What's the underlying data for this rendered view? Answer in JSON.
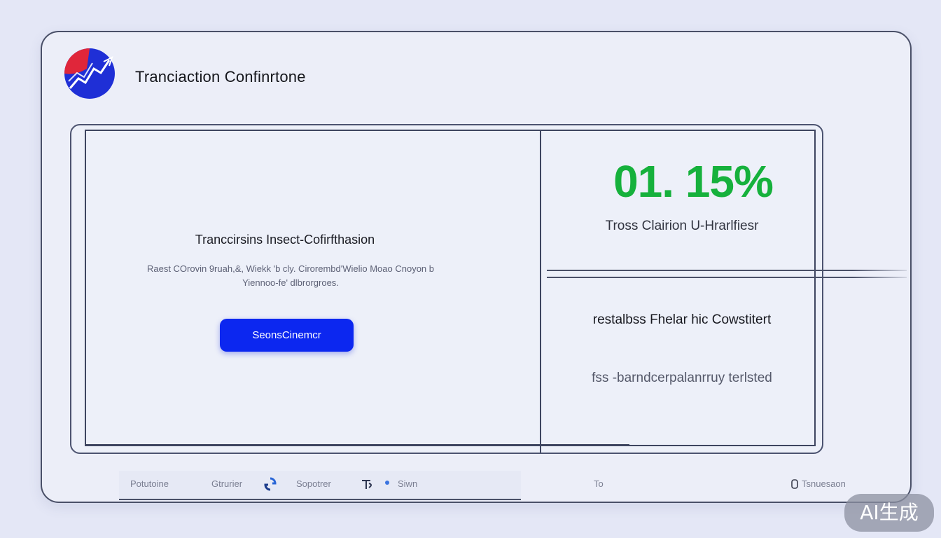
{
  "app": {
    "title": "Tranciaction Confinrtone"
  },
  "main": {
    "heading": "Tranccirsins Insect-Cofirfthasion",
    "description": "Raest COrovin 9ruah,&, Wiekk 'b cly. Cirorembd'Wielio Moao Cnoyon b Yiennoo-fe' dlbrorgroes.",
    "confirm_button": "SeonsCinemcr"
  },
  "summary": {
    "percent": "01. 15%",
    "percent_label": "Tross Clairion U-Hrarlfiesr",
    "detail_primary": "restalbss Fhelar hic Cowstitert",
    "detail_secondary": "fss -barndcerpalanrruy terlsted"
  },
  "status_bar": {
    "item_1": "Potutoine",
    "item_2": "Gtrurier",
    "item_3": "Sopotrer",
    "item_4": "Siwn",
    "item_5": "To",
    "item_6": "Tsnuesaon"
  },
  "icons": {
    "logo": "chart-logo-icon",
    "sync": "sync-icon",
    "currency": "currency-icon",
    "dot": "dot-icon",
    "lock": "lock-icon"
  },
  "colors": {
    "accent_blue": "#0c27f0",
    "success_green": "#16b13c",
    "logo_red": "#e0263a",
    "logo_blue": "#1f2fd6"
  },
  "watermark": "AI生成"
}
